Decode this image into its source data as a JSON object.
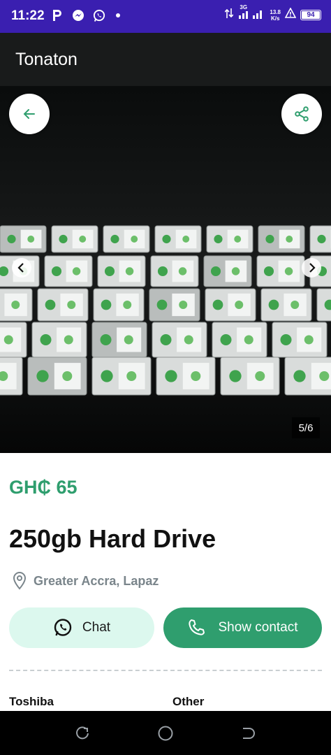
{
  "status_bar": {
    "time": "11:22",
    "network": "3G",
    "speed_value": "13.8",
    "speed_unit": "K/s",
    "battery": "94",
    "icons": [
      "parking-p-icon",
      "messenger-icon",
      "whatsapp-icon",
      "notification-dot-icon",
      "data-arrows-icon",
      "signal-icon",
      "alarm-icon",
      "battery-icon"
    ]
  },
  "app_bar": {
    "title": "Tonaton"
  },
  "gallery": {
    "counter": "5/6",
    "current": 5,
    "total": 6,
    "icons": [
      "back-arrow-icon",
      "share-icon",
      "chevron-left-icon",
      "chevron-right-icon"
    ]
  },
  "listing": {
    "price": "GH₵ 65",
    "title": "250gb Hard Drive",
    "location": "Greater Accra, Lapaz"
  },
  "actions": {
    "chat_label": "Chat",
    "contact_label": "Show contact"
  },
  "attributes": {
    "brand": "Toshiba",
    "type": "Other"
  },
  "colors": {
    "status_bar": "#3a1fb0",
    "app_bar": "#191b1b",
    "accent": "#2f9e6e",
    "chat_bg": "#dcf8ee"
  }
}
